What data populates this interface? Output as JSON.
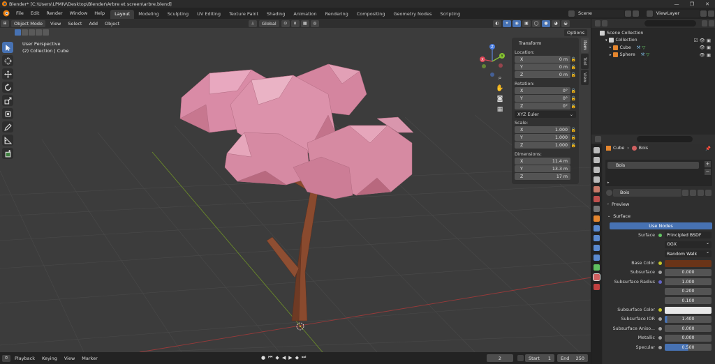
{
  "window": {
    "title": "Blender* [C:\\Users\\LPMIV\\Desktop\\Blender\\Arbre et screen\\arbre.blend]",
    "minimize": "—",
    "maximize": "❐",
    "close": "✕"
  },
  "menus": [
    "File",
    "Edit",
    "Render",
    "Window",
    "Help"
  ],
  "workspaces": [
    "Layout",
    "Modeling",
    "Sculpting",
    "UV Editing",
    "Texture Paint",
    "Shading",
    "Animation",
    "Rendering",
    "Compositing",
    "Geometry Nodes",
    "Scripting"
  ],
  "active_workspace": "Layout",
  "scene": {
    "name": "Scene",
    "view_layer": "ViewLayer"
  },
  "viewport_header": {
    "mode": "Object Mode",
    "menus": [
      "View",
      "Select",
      "Add",
      "Object"
    ],
    "orientation": "Global",
    "options": "Options"
  },
  "viewport_info": {
    "line1": "User Perspective",
    "line2": "(2) Collection | Cube"
  },
  "gizmo": {
    "z": "Z",
    "y": "Y",
    "x": "X"
  },
  "transform_panel": {
    "title": "Transform",
    "location_label": "Location:",
    "location": [
      {
        "axis": "X",
        "value": "0 m"
      },
      {
        "axis": "Y",
        "value": "0 m"
      },
      {
        "axis": "Z",
        "value": "0 m"
      }
    ],
    "rotation_label": "Rotation:",
    "rotation": [
      {
        "axis": "X",
        "value": "0°"
      },
      {
        "axis": "Y",
        "value": "0°"
      },
      {
        "axis": "Z",
        "value": "0°"
      }
    ],
    "rotation_mode": "XYZ Euler",
    "scale_label": "Scale:",
    "scale": [
      {
        "axis": "X",
        "value": "1.000"
      },
      {
        "axis": "Y",
        "value": "1.000"
      },
      {
        "axis": "Z",
        "value": "1.000"
      }
    ],
    "dimensions_label": "Dimensions:",
    "dimensions": [
      {
        "axis": "X",
        "value": "11.4 m"
      },
      {
        "axis": "Y",
        "value": "13.3 m"
      },
      {
        "axis": "Z",
        "value": "17 m"
      }
    ]
  },
  "n_tabs": [
    "Item",
    "Tool",
    "View"
  ],
  "timeline": {
    "menus": [
      "Playback",
      "Keying",
      "View",
      "Marker"
    ],
    "current_frame": "2",
    "start_label": "Start",
    "start": "1",
    "end_label": "End",
    "end": "250"
  },
  "outliner": {
    "items": [
      {
        "name": "Scene Collection",
        "indent": 0
      },
      {
        "name": "Collection",
        "indent": 1
      },
      {
        "name": "Cube",
        "indent": 2
      },
      {
        "name": "Sphere",
        "indent": 2
      }
    ]
  },
  "properties": {
    "object": "Cube",
    "material": "Bois",
    "slot": "Bois",
    "preview_label": "Preview",
    "surface_panel": "Surface",
    "use_nodes": "Use Nodes",
    "rows": [
      {
        "label": "Surface",
        "value": "Principled BSDF",
        "kind": "node",
        "dot": "#63c763"
      },
      {
        "label": "",
        "value": "GGX",
        "kind": "dd"
      },
      {
        "label": "",
        "value": "Random Walk",
        "kind": "dd"
      },
      {
        "label": "Base Color",
        "value": "",
        "kind": "color",
        "dot": "#c7c729",
        "color": "#6a3418"
      },
      {
        "label": "Subsurface",
        "value": "0.000",
        "kind": "num",
        "dot": "#a1a1a1"
      },
      {
        "label": "Subsurface Radius",
        "value": "1.000",
        "kind": "num",
        "dot": "#6363c7"
      },
      {
        "label": "",
        "value": "0.200",
        "kind": "num"
      },
      {
        "label": "",
        "value": "0.100",
        "kind": "num"
      },
      {
        "label": "Subsurface Color",
        "value": "",
        "kind": "color",
        "dot": "#c7c729",
        "color": "#e8e8e8"
      },
      {
        "label": "Subsurface IOR",
        "value": "1.400",
        "kind": "num",
        "dot": "#a1a1a1",
        "fill": 0.05
      },
      {
        "label": "Subsurface Aniso...",
        "value": "0.000",
        "kind": "num",
        "dot": "#a1a1a1"
      },
      {
        "label": "Metallic",
        "value": "0.000",
        "kind": "num",
        "dot": "#a1a1a1"
      },
      {
        "label": "Specular",
        "value": "0.500",
        "kind": "num",
        "dot": "#a1a1a1",
        "fill": 0.5
      }
    ]
  }
}
